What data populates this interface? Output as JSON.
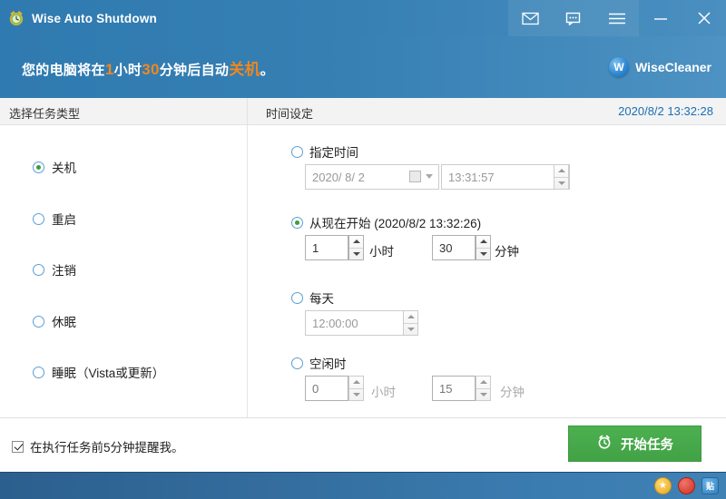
{
  "titlebar": {
    "app_title": "Wise Auto Shutdown",
    "app_icon": "alarm-clock-icon",
    "buttons": [
      {
        "name": "mail-icon",
        "label": ""
      },
      {
        "name": "feedback-icon",
        "label": ""
      },
      {
        "name": "menu-icon",
        "label": ""
      },
      {
        "name": "minimize-icon",
        "label": ""
      },
      {
        "name": "close-icon",
        "label": ""
      }
    ]
  },
  "banner": {
    "prefix": "您的电脑将在",
    "hours": "1",
    "mid1": "小时",
    "minutes": "30",
    "mid2": "分钟后自动",
    "action": "关机",
    "suffix": "。",
    "highlight_color": "#f0871f",
    "brand_logo_letter": "W",
    "brand_name": "WiseCleaner"
  },
  "sections": {
    "left_header": "选择任务类型",
    "right_header": "时间设定",
    "clock": "2020/8/2 13:32:28",
    "clock_color": "#1a6fb5"
  },
  "tasks": [
    {
      "label": "关机",
      "selected": true
    },
    {
      "label": "重启",
      "selected": false
    },
    {
      "label": "注销",
      "selected": false
    },
    {
      "label": "休眠",
      "selected": false
    },
    {
      "label": "睡眠（Vista或更新）",
      "selected": false
    }
  ],
  "time_options": {
    "specified": {
      "label": "指定时间",
      "selected": false,
      "date_value": "2020/ 8/ 2",
      "time_value": "13:31:57"
    },
    "from_now": {
      "label": "从现在开始 (2020/8/2 13:32:26)",
      "selected": true,
      "hours_value": "1",
      "hours_unit": "小时",
      "minutes_value": "30",
      "minutes_unit": "分钟"
    },
    "daily": {
      "label": "每天",
      "selected": false,
      "time_value": "12:00:00"
    },
    "idle": {
      "label": "空闲时",
      "selected": false,
      "hours_value": "0",
      "hours_unit": "小时",
      "minutes_value": "15",
      "minutes_unit": "分钟"
    }
  },
  "footer": {
    "remind_label": "在执行任务前5分钟提醒我。",
    "remind_checked": true,
    "start_button_label": "开始任务",
    "start_button_icon": "alarm-clock-icon",
    "start_button_color": "#45a849"
  },
  "taskbar": {
    "tray": [
      {
        "name": "star-tray-icon",
        "glyph": "★"
      },
      {
        "name": "red-tray-icon",
        "glyph": ""
      },
      {
        "name": "paste-tray-icon",
        "glyph": "贴"
      }
    ]
  }
}
